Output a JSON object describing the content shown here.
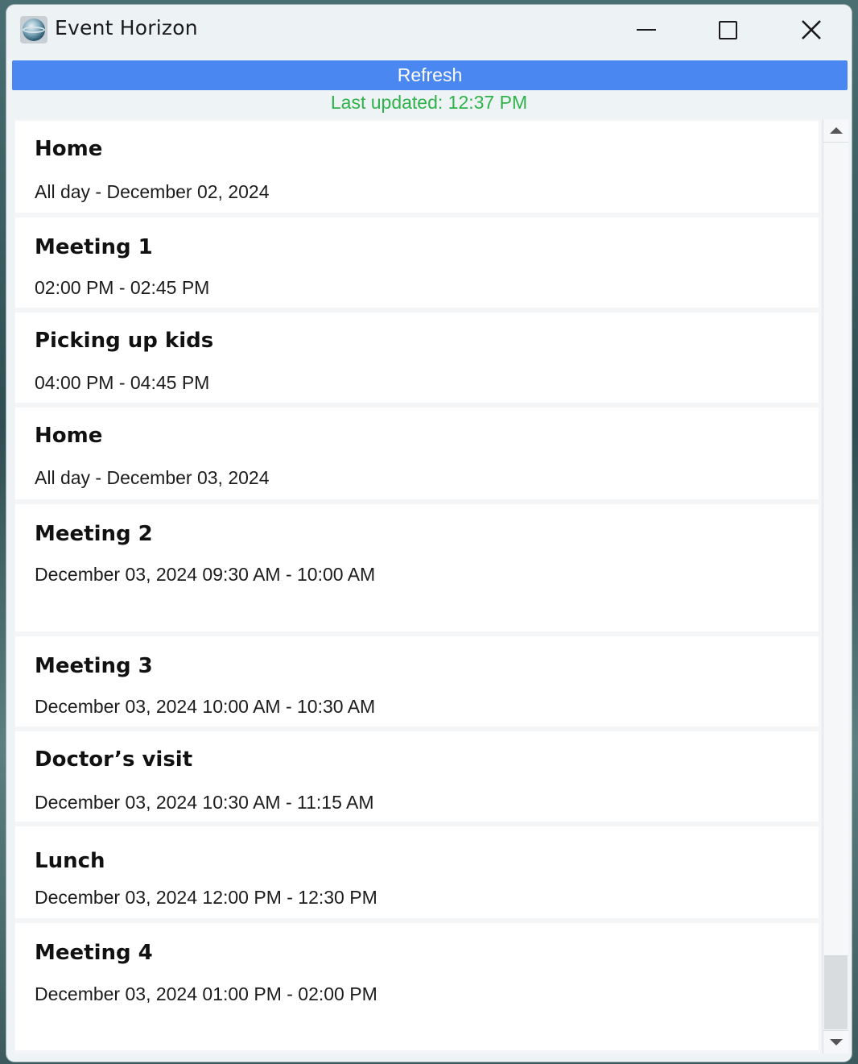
{
  "window": {
    "title": "Event Horizon",
    "icon": "app-globe-icon",
    "controls": {
      "minimize": "minimize-icon",
      "maximize": "maximize-icon",
      "close": "close-icon"
    }
  },
  "toolbar": {
    "refresh_label": "Refresh",
    "accent_color": "#4a87f0"
  },
  "status": {
    "last_updated": "Last updated: 12:37 PM",
    "color": "#2fb24a"
  },
  "events": [
    {
      "title": "Home",
      "time": "All day - December 02, 2024"
    },
    {
      "title": "Meeting 1",
      "time": "02:00 PM - 02:45 PM"
    },
    {
      "title": "Picking up kids",
      "time": "04:00 PM - 04:45 PM"
    },
    {
      "title": "Home",
      "time": "All day - December 03, 2024"
    },
    {
      "title": "Meeting 2",
      "time": "December 03, 2024 09:30 AM - 10:00 AM"
    },
    {
      "title": "Meeting 3",
      "time": "December 03, 2024 10:00 AM - 10:30 AM"
    },
    {
      "title": "Doctor’s visit",
      "time": "December 03, 2024 10:30 AM - 11:15 AM"
    },
    {
      "title": "Lunch",
      "time": "December 03, 2024 12:00 PM - 12:30 PM"
    },
    {
      "title": "Meeting 4",
      "time": "December 03, 2024 01:00 PM - 02:00 PM"
    }
  ]
}
